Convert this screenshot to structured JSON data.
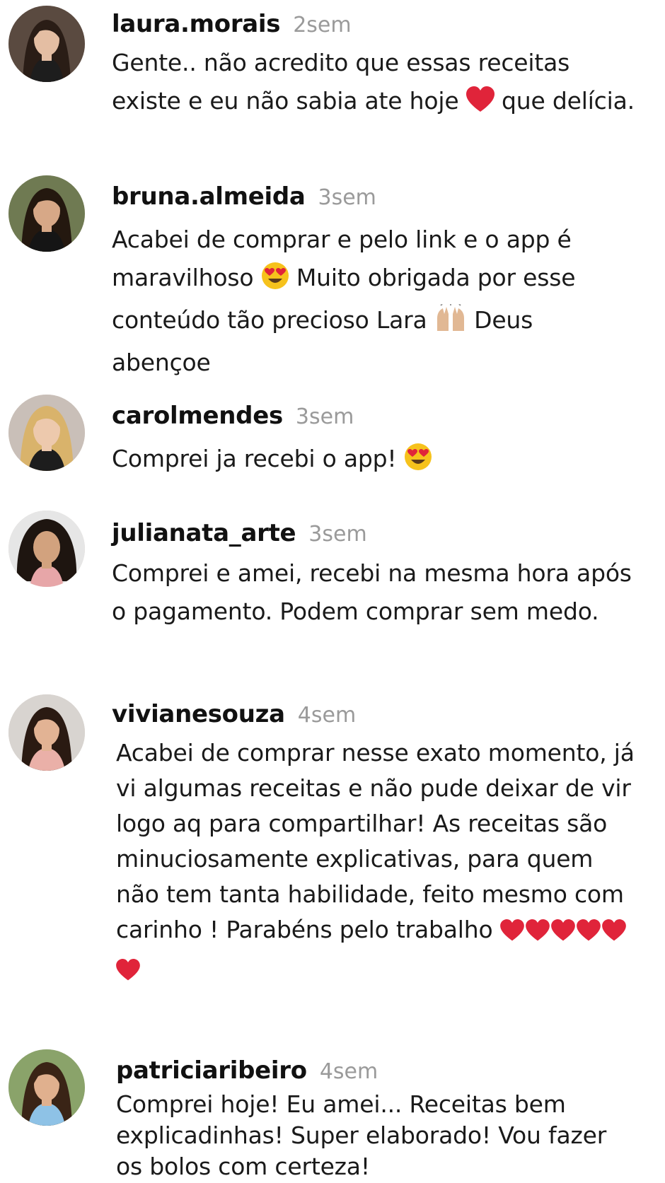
{
  "colors": {
    "username": "#111111",
    "timestamp": "#9a9a9a",
    "heart": "#e0243a",
    "background": "#ffffff"
  },
  "comments": [
    {
      "user": "laura.morais",
      "time": "2sem",
      "text_a": "Gente.. não acredito que essas receitas existe e eu não sabia ate hoje ",
      "emoji_a": "red-heart",
      "text_b": " que delícia."
    },
    {
      "user": "bruna.almeida",
      "time": "3sem",
      "text_a": "Acabei de comprar e pelo link e o app é maravilhoso ",
      "emoji_a": "heart-eyes",
      "text_b": " Muito obrigada por esse conteúdo tão precioso Lara ",
      "emoji_b": "raised-hands",
      "text_c": " Deus abençoe"
    },
    {
      "user": "carolmendes",
      "time": "3sem",
      "text_a": "Comprei ja recebi o app! ",
      "emoji_a": "heart-eyes"
    },
    {
      "user": "julianata_arte",
      "time": "3sem",
      "text_a": "Comprei e amei, recebi na mesma hora após o pagamento. Podem comprar sem medo."
    },
    {
      "user": "vivianesouza",
      "time": "4sem",
      "text_a": "Acabei de comprar nesse exato momento, já vi algumas receitas e não pude deixar de vir logo aq para compartilhar! As receitas são minuciosamente explicativas, para quem não tem tanta habilidade, feito mesmo com carinho ! Parabéns pelo trabalho ",
      "emoji_a": "red-heart x6"
    },
    {
      "user": "patriciaribeiro",
      "time": "4sem",
      "text_a": "Comprei hoje! Eu amei... Receitas bem explicadinhas! Super elaborado! Vou fazer os bolos com certeza!"
    }
  ]
}
